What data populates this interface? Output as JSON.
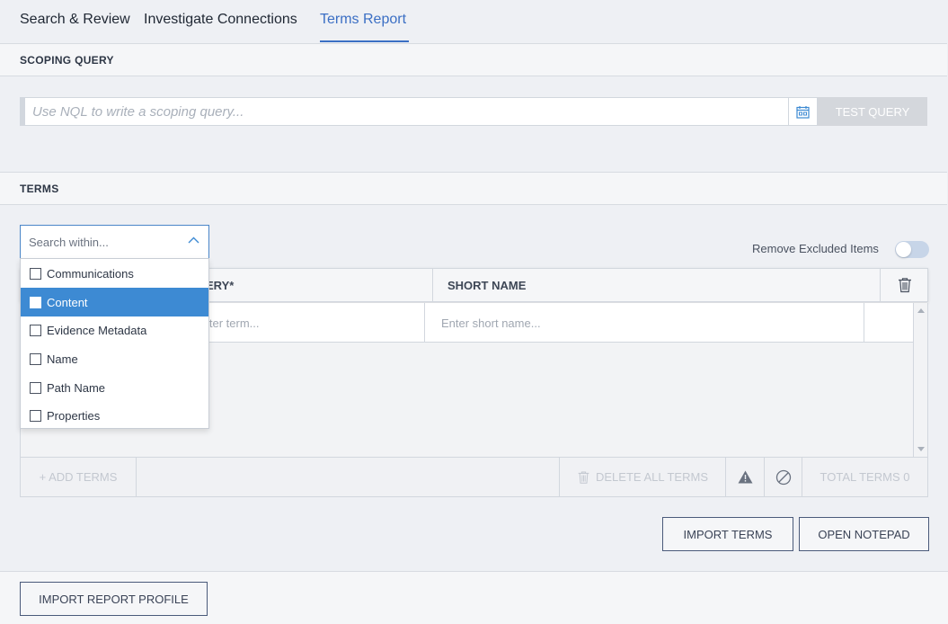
{
  "tabs": [
    {
      "label": "Search & Review"
    },
    {
      "label": "Investigate Connections"
    },
    {
      "label": "Terms Report",
      "active": true
    }
  ],
  "scoping": {
    "header": "SCOPING QUERY",
    "placeholder": "Use NQL to write a scoping query...",
    "test_query_label": "TEST QUERY",
    "calendar_icon": "calendar-icon"
  },
  "terms": {
    "header": "TERMS",
    "search_within_placeholder": "Search within...",
    "options": [
      "Communications",
      "Content",
      "Evidence Metadata",
      "Name",
      "Path Name",
      "Properties"
    ],
    "selected_option": "Content",
    "remove_excluded_label": "Remove Excluded Items",
    "remove_excluded_on": false,
    "columns": {
      "query": "QUERY*",
      "query_visible": "ERY*",
      "short_name": "SHORT NAME"
    },
    "row": {
      "query_placeholder": "Enter term...",
      "short_name_placeholder": "Enter short name..."
    },
    "add_terms_label": "+ ADD TERMS",
    "delete_all_label": "DELETE ALL TERMS",
    "total_terms_label": "TOTAL TERMS 0",
    "import_terms_label": "IMPORT TERMS",
    "open_notepad_label": "OPEN NOTEPAD"
  },
  "import_report_profile_label": "IMPORT REPORT PROFILE",
  "colors": {
    "accent": "#3b6fc4",
    "selected_item": "#3d8ad3",
    "background": "#eef0f4"
  }
}
